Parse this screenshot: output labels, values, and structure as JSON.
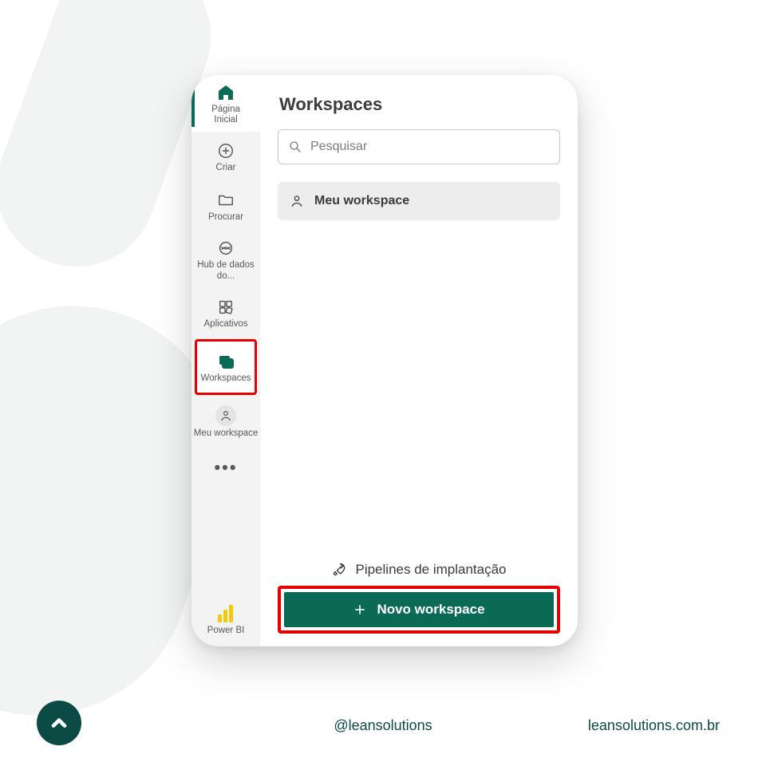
{
  "colors": {
    "accent": "#0b6a55",
    "highlight": "#e60000",
    "brand_dark": "#0b4a45",
    "powerbi_yellow": "#f2c811"
  },
  "sidebar": {
    "items": [
      {
        "label": "Página\nInicial",
        "icon": "home-icon",
        "active": true
      },
      {
        "label": "Criar",
        "icon": "plus-circle-icon"
      },
      {
        "label": "Procurar",
        "icon": "folder-icon"
      },
      {
        "label": "Hub de dados do...",
        "icon": "onelake-icon"
      },
      {
        "label": "Aplicativos",
        "icon": "apps-icon"
      },
      {
        "label": "Workspaces",
        "icon": "workspaces-icon",
        "highlighted": true
      },
      {
        "label": "Meu workspace",
        "icon": "person-icon"
      }
    ],
    "more_label": "•••",
    "bottom": {
      "label": "Power BI",
      "icon": "powerbi-logo-icon"
    }
  },
  "panel": {
    "title": "Workspaces",
    "search": {
      "placeholder": "Pesquisar",
      "value": ""
    },
    "workspace_list": [
      {
        "label": "Meu workspace",
        "icon": "person-icon"
      }
    ],
    "pipelines": {
      "label": "Pipelines de implantação",
      "icon": "rocket-icon"
    },
    "new_workspace": {
      "label": "Novo workspace",
      "icon": "plus-icon"
    }
  },
  "footer": {
    "handle": "@leansolutions",
    "url": "leansolutions.com.br",
    "logo_icon": "chevron-up-icon"
  }
}
